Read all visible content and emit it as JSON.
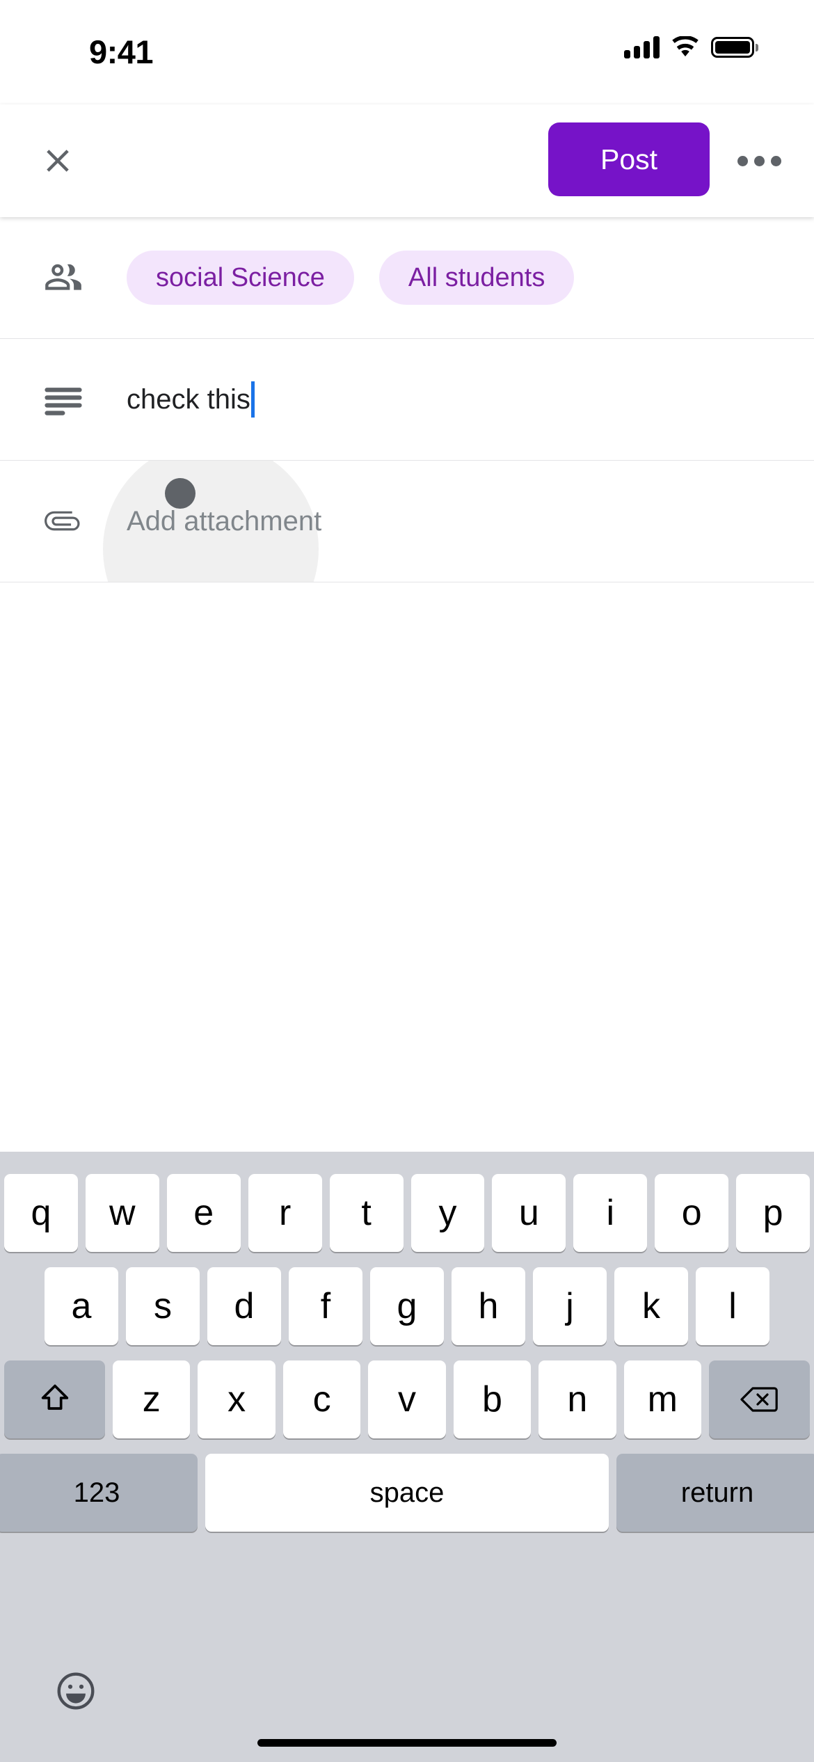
{
  "status_bar": {
    "time": "9:41",
    "cellular_icon": "signal-bars-icon",
    "wifi_icon": "wifi-icon",
    "battery_icon": "battery-full-icon"
  },
  "app_bar": {
    "close_icon": "close-icon",
    "post_label": "Post",
    "more_icon": "more-options-icon",
    "post_button_color": "#7613C8"
  },
  "form": {
    "audience_row": {
      "icon": "people-icon",
      "chips": [
        {
          "label": "social Science"
        },
        {
          "label": "All students"
        }
      ],
      "chip_bg_color": "#F3E5FC",
      "chip_text_color": "#7B1FA2"
    },
    "description_row": {
      "icon": "description-icon",
      "value": "check this",
      "caret_color": "#1a73e8"
    },
    "attachment_row": {
      "icon": "paperclip-icon",
      "label": "Add attachment"
    }
  },
  "keyboard": {
    "background_color": "#D1D3D9",
    "row1": [
      "q",
      "w",
      "e",
      "r",
      "t",
      "y",
      "u",
      "i",
      "o",
      "p"
    ],
    "row2": [
      "a",
      "s",
      "d",
      "f",
      "g",
      "h",
      "j",
      "k",
      "l"
    ],
    "row3_letters": [
      "z",
      "x",
      "c",
      "v",
      "b",
      "n",
      "m"
    ],
    "shift_icon": "shift-icon",
    "backspace_icon": "backspace-icon",
    "numbers_label": "123",
    "space_label": "space",
    "return_label": "return",
    "emoji_icon": "emoji-icon"
  }
}
